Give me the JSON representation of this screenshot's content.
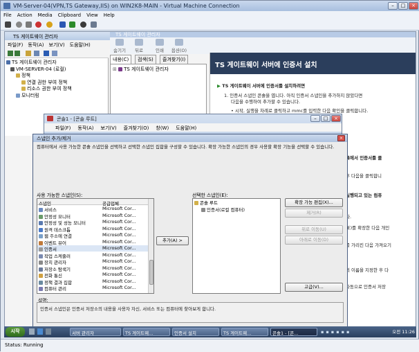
{
  "vm": {
    "title": "VM-Server-04(VPN,TS Gateway,IIS) on WIN2K8-MAIN - Virtual Machine Connection",
    "menu": [
      "File",
      "Action",
      "Media",
      "Clipboard",
      "View",
      "Help"
    ],
    "status": "Status: Running"
  },
  "ts_manager": {
    "title": "TS 게이트웨이 관리자",
    "menu": [
      "파일(F)",
      "동작(A)",
      "보기(V)",
      "도움말(H)"
    ],
    "tree": [
      "TS 게이트웨이 관리자",
      "VM-SERVER-04 (로컬)",
      "정책",
      "연결 권한 부여 정책",
      "리소스 권한 부여 정책",
      "모니터링"
    ]
  },
  "inner": {
    "title": "TS 게이트웨이 관리자",
    "toolbar": [
      "숨기기",
      "뒤로",
      "인쇄",
      "옵션(O)"
    ],
    "tabs": [
      "내용(C)",
      "검색(S)",
      "즐겨찾기(I)"
    ],
    "tree_item": "TS 게이트웨이 관리자"
  },
  "help": {
    "title": "TS 게이트웨이 서버에 인증서 설치",
    "heading": "TS 게이트웨이 서버에 인증서를 설치하려면",
    "step1a": "1.  인증서 스냅인 콘솔을 엽니다. 아직 인증서 스냅인을 추가하지 않았다면",
    "step1b": "다음을 수행하여 추가할 수 있습니다.",
    "bullet": "• 시작, 실행을 차례로 클릭하고 mmc를 입력한 다음 확인을 클릭합니다.",
    "frag1": "록에서 인증서를 클",
    "frag2": "후 다음을 클릭합니",
    "frag3": "실행되고 있는 컴퓨",
    "frag4": "다.",
    "frag5": "(E)를 확장한 다음 개인",
    "frag6": "를 가리킨 다음 가져오기",
    "frag7": "의 이름을 지정한 후 다",
    "frag8": "자동으로 인증서 저장"
  },
  "console": {
    "title": "콘솔1 - [콘솔 루트]",
    "menu": [
      "파일(F)",
      "동작(A)",
      "보기(V)",
      "즐겨찾기(O)",
      "창(W)",
      "도움말(H)"
    ]
  },
  "dialog": {
    "title": "스냅인 추가/제거",
    "description": "컴퓨터에서 사용 가능한 콘솔 스냅인을 선택하고 선택한 스냅인 집합을 구성할 수 있습니다. 확장 가능한 스냅인의 경우 사용할 확장 기능을 선택할 수 있습니다.",
    "available_label": "사용 가능한 스냅인(S):",
    "columns": [
      "스냅인",
      "공급업체"
    ],
    "available": [
      {
        "name": "서비스",
        "vendor": "Microsoft Cor..."
      },
      {
        "name": "안정성 모니터",
        "vendor": "Microsoft Cor..."
      },
      {
        "name": "안정성 및 성능 모니터",
        "vendor": "Microsoft Cor..."
      },
      {
        "name": "원격 데스크톱",
        "vendor": "Microsoft Cor..."
      },
      {
        "name": "웹 주소에 연결",
        "vendor": "Microsoft Cor..."
      },
      {
        "name": "이벤트 뷰어",
        "vendor": "Microsoft Cor..."
      },
      {
        "name": "인증서",
        "vendor": "Microsoft Cor..."
      },
      {
        "name": "작업 스케줄러",
        "vendor": "Microsoft Cor..."
      },
      {
        "name": "장치 관리자",
        "vendor": "Microsoft Cor..."
      },
      {
        "name": "저장소 탐색기",
        "vendor": "Microsoft Cor..."
      },
      {
        "name": "전화 통신",
        "vendor": "Microsoft Cor..."
      },
      {
        "name": "정책 결과 집합",
        "vendor": "Microsoft Cor..."
      },
      {
        "name": "컴퓨터 관리",
        "vendor": "Microsoft Cor..."
      }
    ],
    "add_button": "추가(A) >",
    "selected_label": "선택한 스냅인(E):",
    "selected": [
      "콘솔 루트",
      "인증서(로컬 컴퓨터)"
    ],
    "buttons": {
      "edit_ext": "확장 가능 편집(X)...",
      "remove": "제거(R)",
      "move_up": "위로 이동(U)",
      "move_down": "아래로 이동(D)",
      "advanced": "고급(V)...",
      "ok": "확인",
      "cancel": "취소"
    },
    "desc_label": "설명:",
    "desc_text": "인증서 스냅인은 인증서 저장소의 내용을 사용자 자신, 서비스 또는 컴퓨터에 찾아보게 합니다."
  },
  "taskbar": {
    "start": "시작",
    "tasks": [
      "서버 관리자",
      "TS 게이트웨...",
      "TS 게이트웨...",
      "인증서 설치",
      "TS 게이트웨...",
      "콘솔1 - [콘..."
    ],
    "clock": "오전 11:26"
  }
}
